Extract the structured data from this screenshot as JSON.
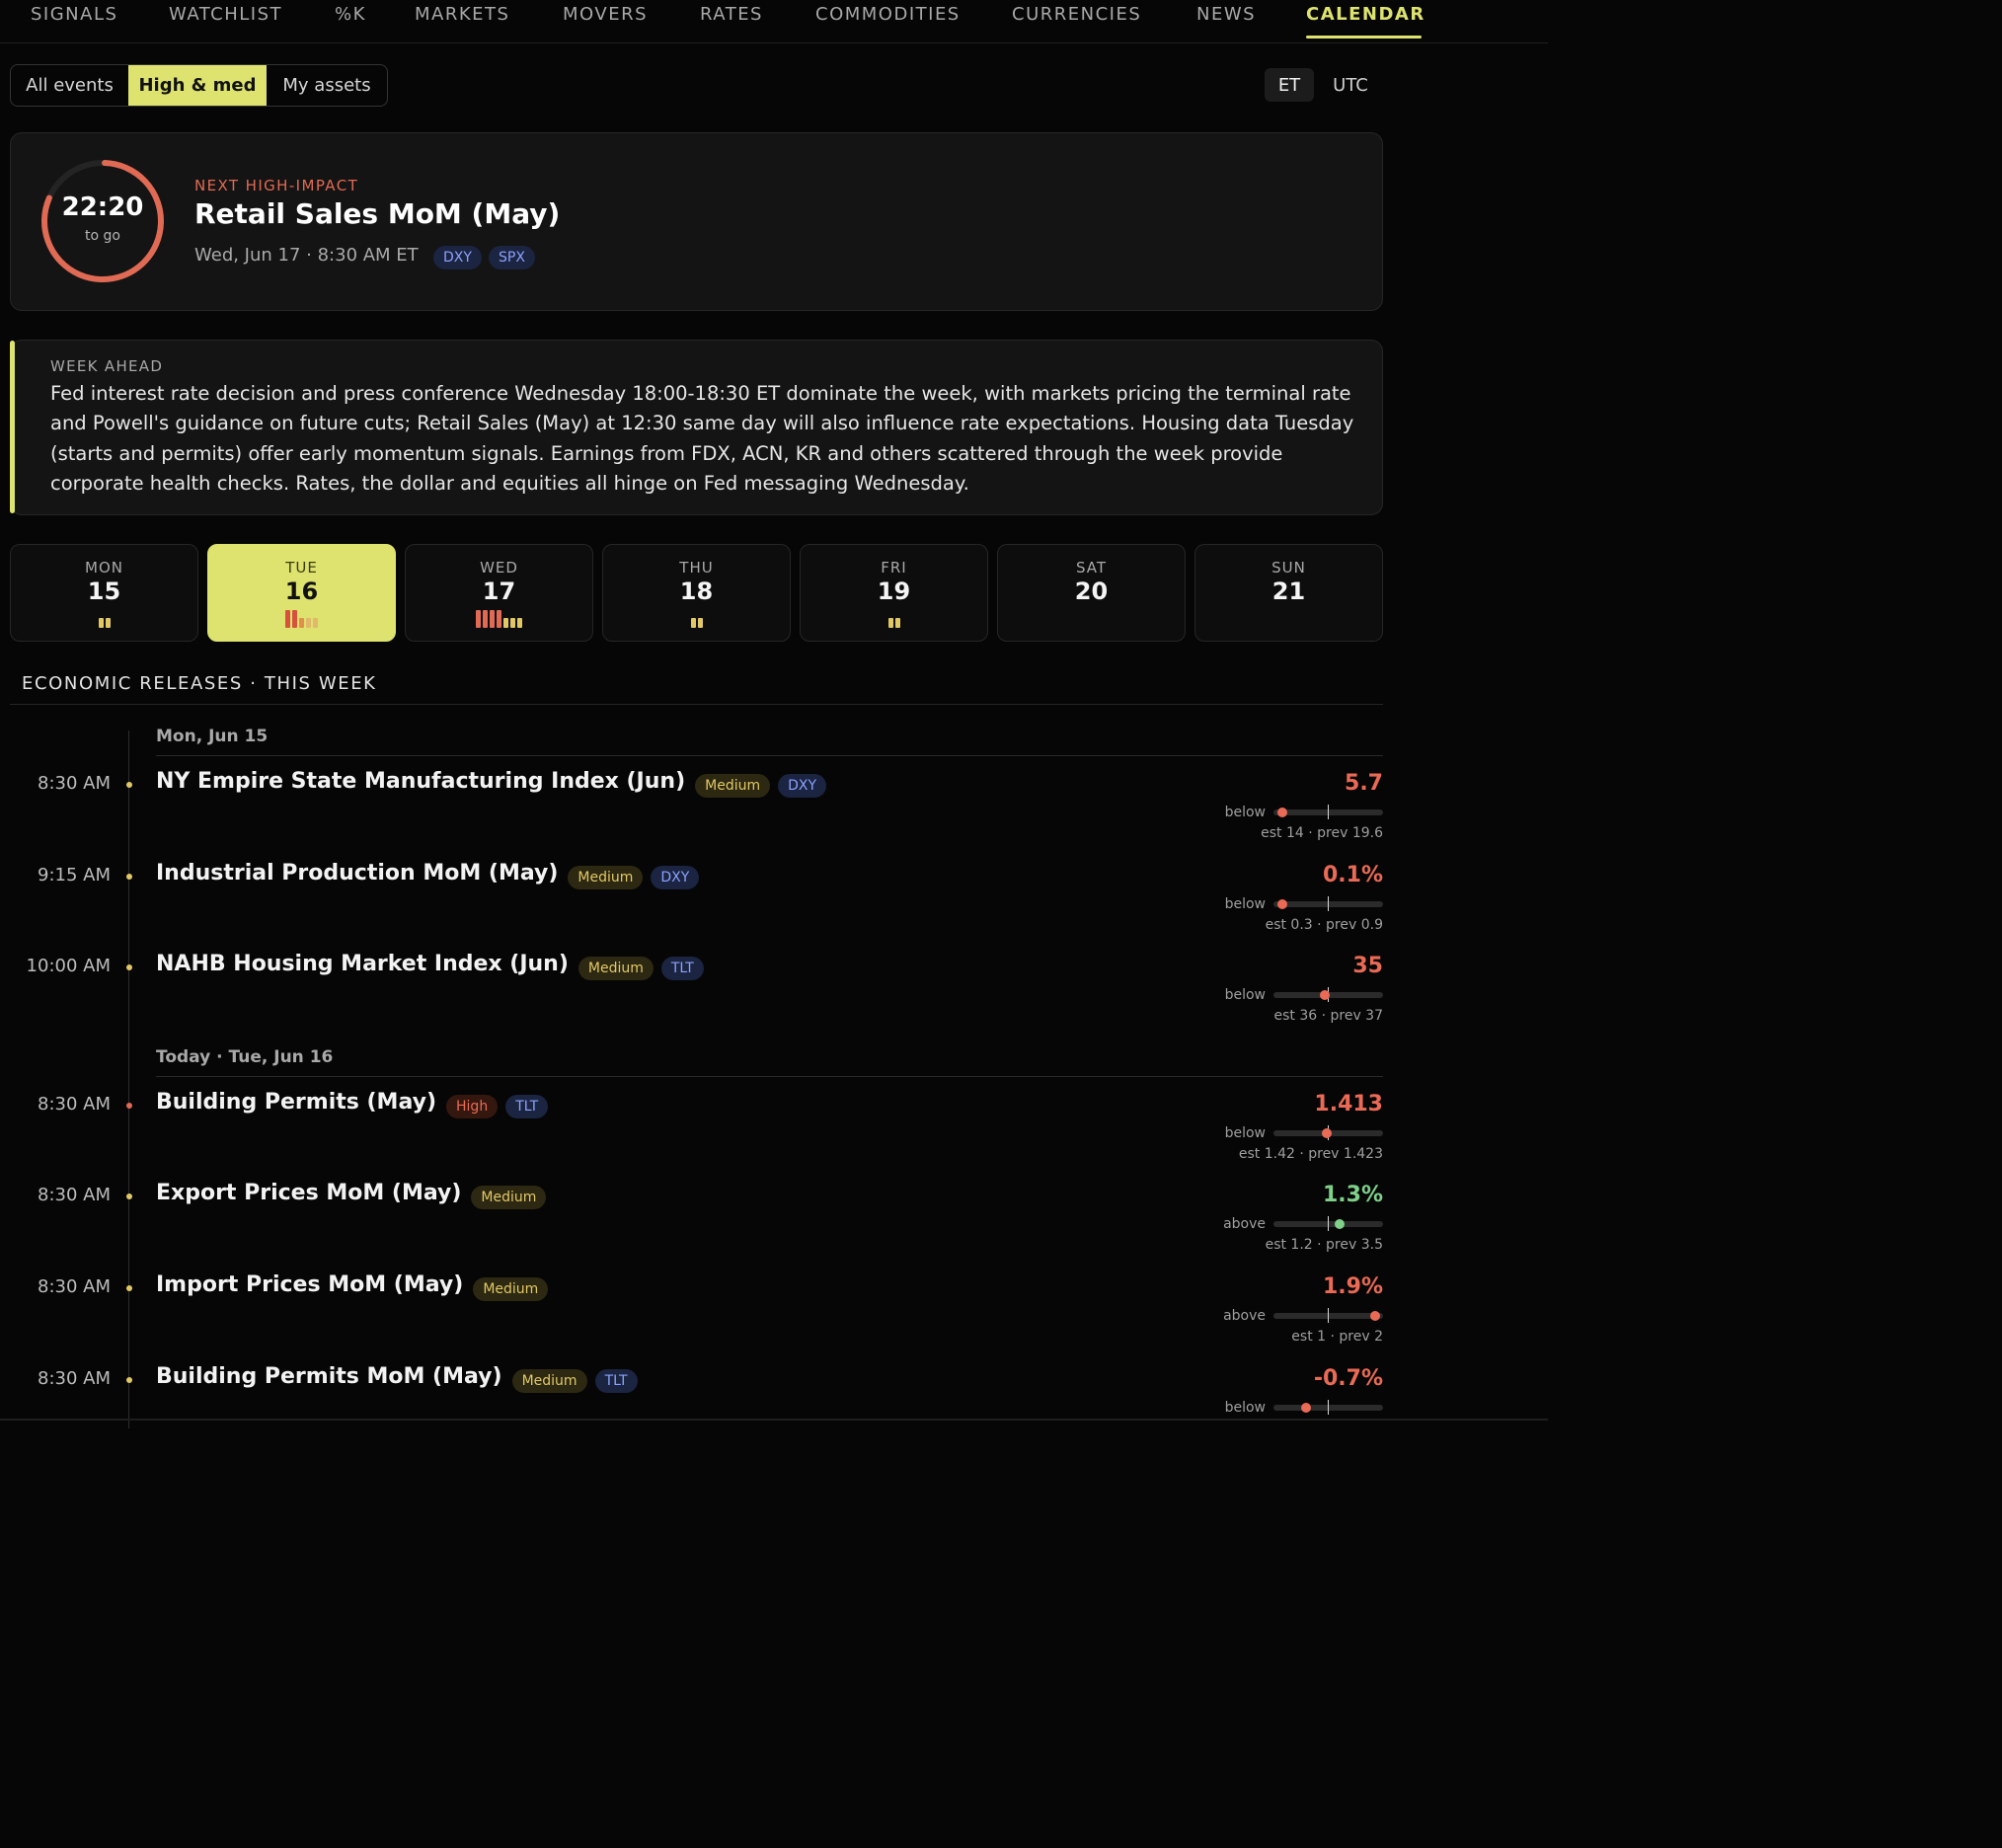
{
  "nav": {
    "items": [
      "SIGNALS",
      "WATCHLIST",
      "%K",
      "MARKETS",
      "MOVERS",
      "RATES",
      "COMMODITIES",
      "CURRENCIES",
      "NEWS",
      "CALENDAR"
    ],
    "active": "CALENDAR"
  },
  "filters": {
    "options": [
      "All events",
      "High & med",
      "My assets"
    ],
    "selected": "High & med"
  },
  "timezone": {
    "options": [
      "ET",
      "UTC"
    ],
    "selected": "ET"
  },
  "next_event": {
    "countdown": "22:20",
    "countdown_sub": "to go",
    "label": "NEXT HIGH-IMPACT",
    "title": "Retail Sales MoM (May)",
    "when": "Wed, Jun 17 · 8:30 AM ET",
    "assets": [
      "DXY",
      "SPX"
    ]
  },
  "week_ahead": {
    "label": "WEEK AHEAD",
    "text": "Fed interest rate decision and press conference Wednesday 18:00-18:30 ET dominate the week, with markets pricing the terminal rate and Powell's guidance on future cuts; Retail Sales (May) at 12:30 same day will also influence rate expectations. Housing data Tuesday (starts and permits) offer early momentum signals. Earnings from FDX, ACN, KR and others scattered through the week provide corporate health checks. Rates, the dollar and equities all hinge on Fed messaging Wednesday."
  },
  "days": [
    {
      "dow": "MON",
      "num": "15",
      "high": 0,
      "medium": 2,
      "low": 0
    },
    {
      "dow": "TUE",
      "num": "16",
      "high": 2,
      "medium": 1,
      "low": 2,
      "active": true
    },
    {
      "dow": "WED",
      "num": "17",
      "high": 4,
      "medium": 3,
      "low": 0
    },
    {
      "dow": "THU",
      "num": "18",
      "high": 0,
      "medium": 2,
      "low": 0
    },
    {
      "dow": "FRI",
      "num": "19",
      "high": 0,
      "medium": 2,
      "low": 0
    },
    {
      "dow": "SAT",
      "num": "20",
      "high": 0,
      "medium": 0,
      "low": 0
    },
    {
      "dow": "SUN",
      "num": "21",
      "high": 0,
      "medium": 0,
      "low": 0
    }
  ],
  "releases": {
    "title": "ECONOMIC RELEASES · THIS WEEK",
    "groups": [
      {
        "date": "Mon, Jun 15"
      },
      {
        "date": "Today · Tue, Jun 16"
      }
    ],
    "rows": [
      {
        "time": "8:30 AM",
        "title": "NY Empire State Manufacturing Index (Jun)",
        "impact": "Medium",
        "assets": [
          "DXY"
        ],
        "actual": "5.7",
        "direction": "below",
        "est_prev": "est 14 · prev 19.6",
        "position": 0.08
      },
      {
        "time": "9:15 AM",
        "title": "Industrial Production MoM (May)",
        "impact": "Medium",
        "assets": [
          "DXY"
        ],
        "actual": "0.1%",
        "direction": "below",
        "est_prev": "est 0.3 · prev 0.9",
        "position": 0.08
      },
      {
        "time": "10:00 AM",
        "title": "NAHB Housing Market Index (Jun)",
        "impact": "Medium",
        "assets": [
          "TLT"
        ],
        "actual": "35",
        "direction": "below",
        "est_prev": "est 36 · prev 37",
        "position": 0.47
      },
      {
        "time": "8:30 AM",
        "title": "Building Permits (May)",
        "impact": "High",
        "assets": [
          "TLT"
        ],
        "actual": "1.413",
        "direction": "below",
        "est_prev": "est 1.42 · prev 1.423",
        "position": 0.49
      },
      {
        "time": "8:30 AM",
        "title": "Export Prices MoM (May)",
        "impact": "Medium",
        "assets": [],
        "actual": "1.3%",
        "direction": "above",
        "est_prev": "est 1.2 · prev 3.5",
        "position": 0.6
      },
      {
        "time": "8:30 AM",
        "title": "Import Prices MoM (May)",
        "impact": "Medium",
        "assets": [],
        "actual": "1.9%",
        "direction": "above",
        "est_prev": "est 1 · prev 2",
        "position": 0.93
      },
      {
        "time": "8:30 AM",
        "title": "Building Permits MoM (May)",
        "impact": "Medium",
        "assets": [
          "TLT"
        ],
        "actual": "-0.7%",
        "direction": "below",
        "est_prev": "",
        "position": 0.3
      }
    ]
  },
  "colors": {
    "accent": "#dde36e",
    "high": "#e06a53",
    "medium": "#e2c865",
    "positive": "#7fd18a",
    "negative": "#ea6a55",
    "asset": "#8aa2ff"
  }
}
